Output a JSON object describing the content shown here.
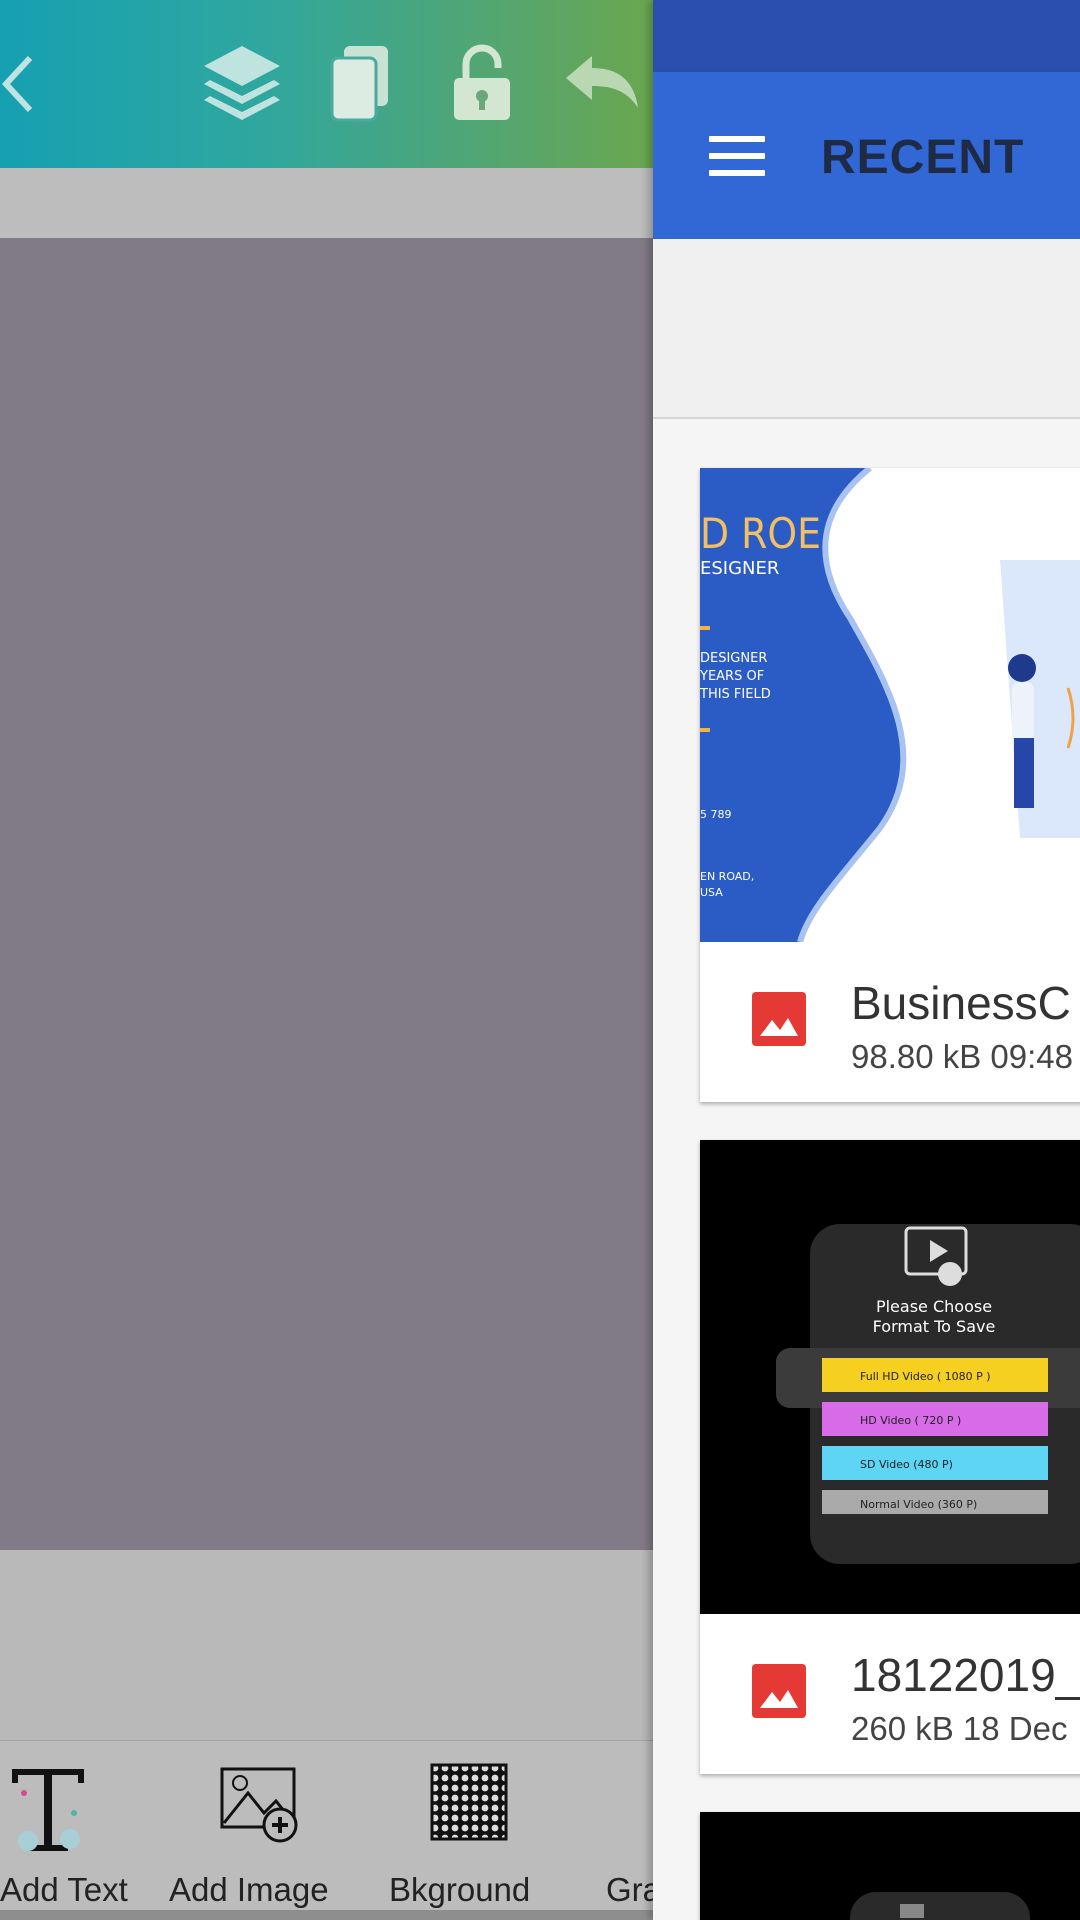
{
  "editor": {
    "tools": [
      {
        "label": "Add Text",
        "icon": "add-text-icon"
      },
      {
        "label": "Add Image",
        "icon": "add-image-icon"
      },
      {
        "label": "Bkground",
        "icon": "background-texture-icon"
      },
      {
        "label": "Gra",
        "icon": "graphics-icon"
      }
    ]
  },
  "picker": {
    "title": "RECENT",
    "files": [
      {
        "name": "BusinessC",
        "meta": "98.80 kB 09:48",
        "thumb": {
          "line1": "D ROE",
          "line2": "ESIGNER",
          "t1": "DESIGNER",
          "t2": "YEARS OF",
          "t3": "THIS FIELD",
          "t4": "5 789",
          "t5": "EN ROAD,",
          "t6": "USA"
        }
      },
      {
        "name": "18122019_",
        "meta": "260 kB 18 Dec",
        "thumb": {
          "heading1": "Please Choose",
          "heading2": "Format To Save",
          "opt1": "Full HD Video ( 1080 P )",
          "opt2": "HD Video ( 720 P )",
          "opt3": "SD Video (480 P)",
          "opt4": "Normal Video (360 P)"
        }
      }
    ]
  },
  "colors": {
    "appbar": "#3267d6",
    "statusbar": "#2a4fae",
    "file_icon": "#e53935",
    "canvas": "#817b87"
  }
}
